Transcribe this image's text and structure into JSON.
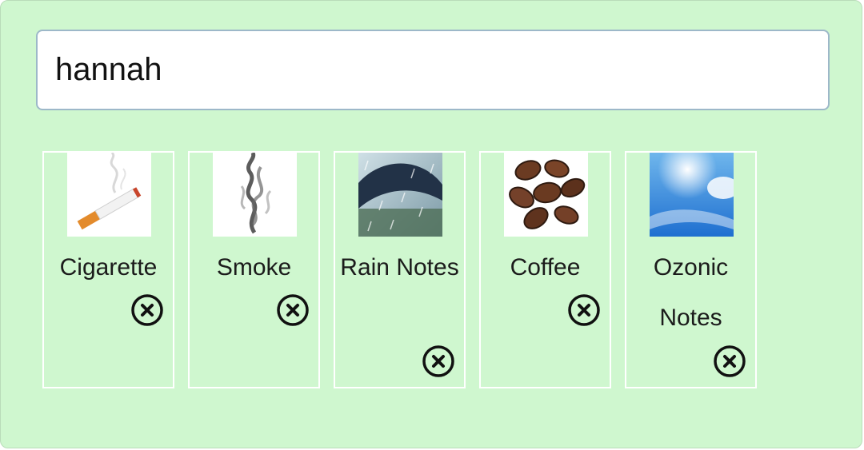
{
  "search": {
    "value": "hannah",
    "accent": "#9db8c9"
  },
  "panel_color": "#cff7cf",
  "notes": [
    {
      "label": "Cigarette",
      "thumb_icon": "cigarette-icon",
      "remove_icon": "close-circle-icon"
    },
    {
      "label": "Smoke",
      "thumb_icon": "smoke-icon",
      "remove_icon": "close-circle-icon"
    },
    {
      "label": "Rain Notes",
      "thumb_icon": "rain-umbrella-icon",
      "remove_icon": "close-circle-icon"
    },
    {
      "label": "Coffee",
      "thumb_icon": "coffee-beans-icon",
      "remove_icon": "close-circle-icon"
    },
    {
      "label": "Ozonic Notes",
      "thumb_icon": "blue-sky-icon",
      "remove_icon": "close-circle-icon"
    }
  ]
}
